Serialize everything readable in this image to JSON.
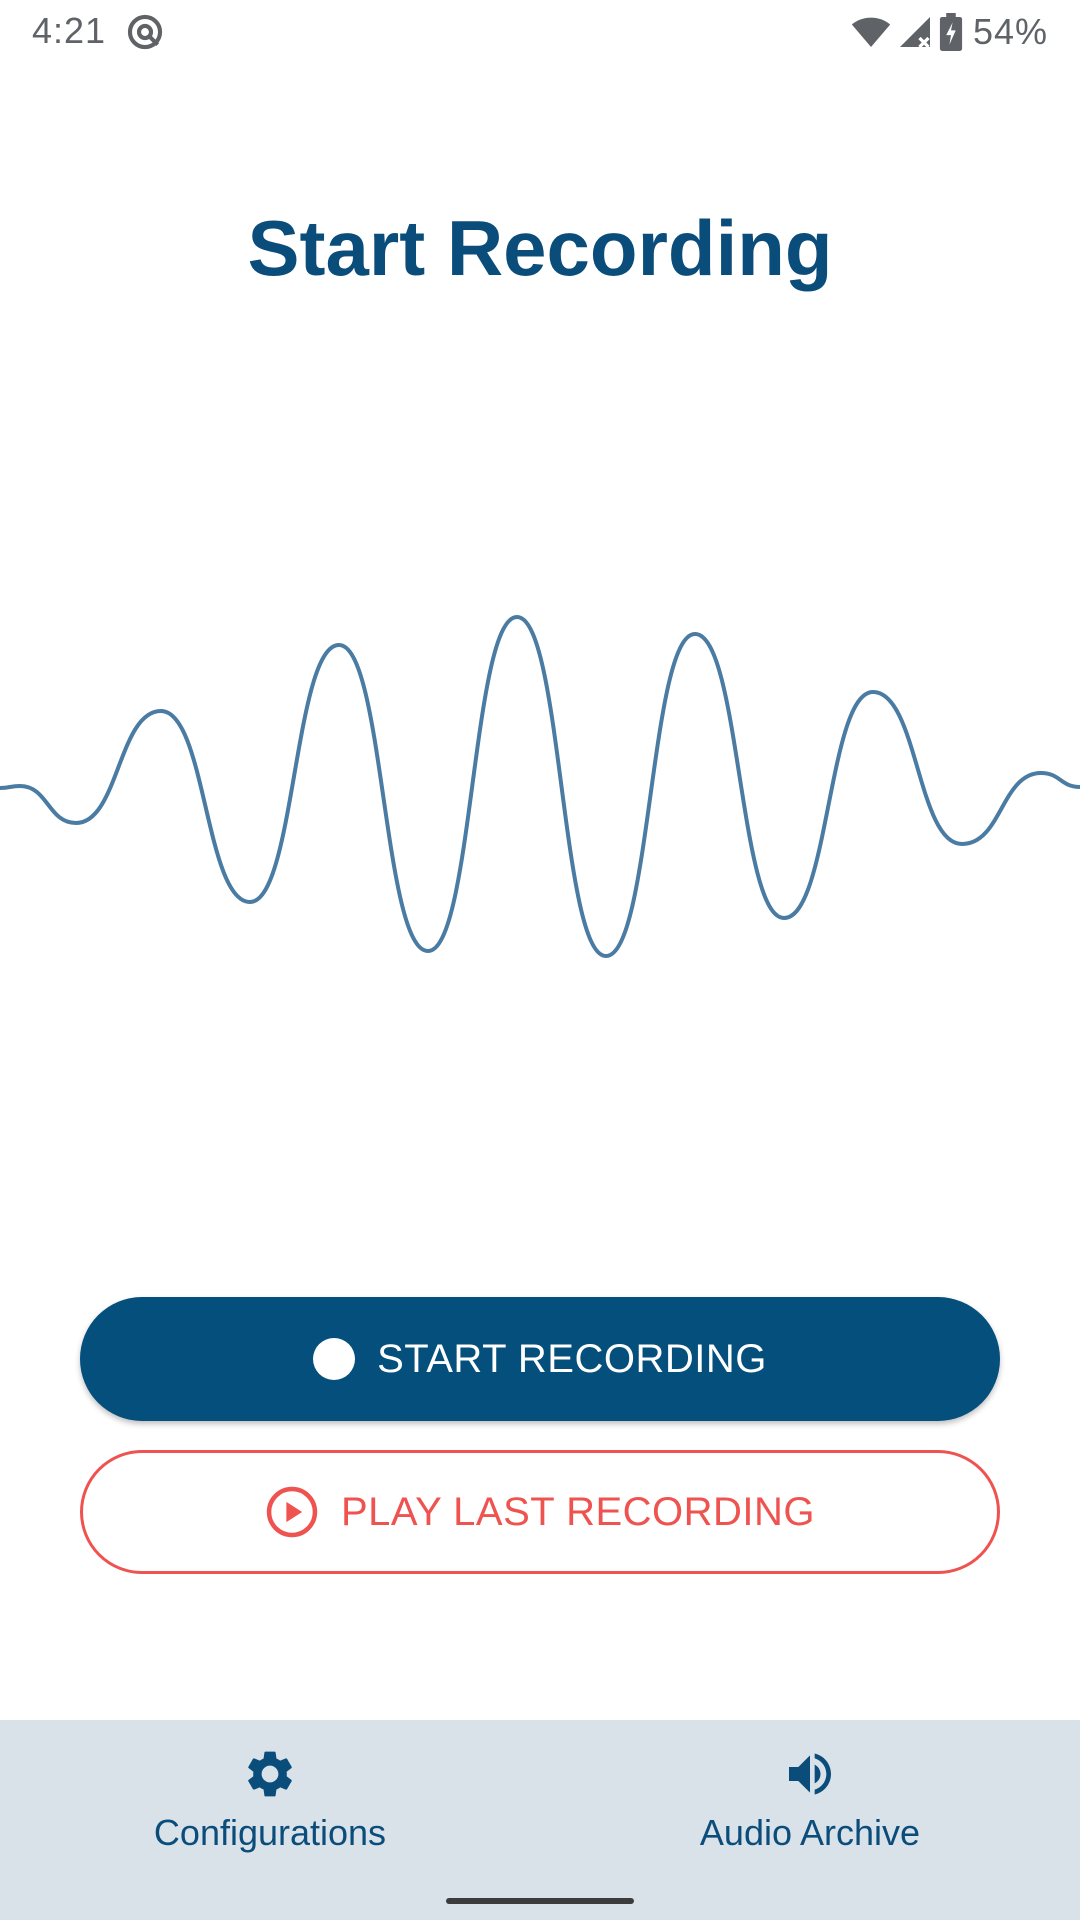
{
  "status_bar": {
    "time": "4:21",
    "battery_percent": "54%",
    "icons": [
      "at-sign-icon",
      "wifi-icon",
      "signal-icon",
      "battery-charging-icon"
    ]
  },
  "main": {
    "title": "Start Recording"
  },
  "buttons": {
    "start_recording_label": "START RECORDING",
    "play_last_label": "PLAY LAST RECORDING"
  },
  "bottom_nav": {
    "items": [
      {
        "label": "Configurations",
        "icon": "gear-icon"
      },
      {
        "label": "Audio Archive",
        "icon": "speaker-icon"
      }
    ]
  },
  "colors": {
    "primary": "#054f7d",
    "accent": "#ef5350",
    "wave": "#4a7ba3",
    "nav_background": "#d9e1e9"
  }
}
